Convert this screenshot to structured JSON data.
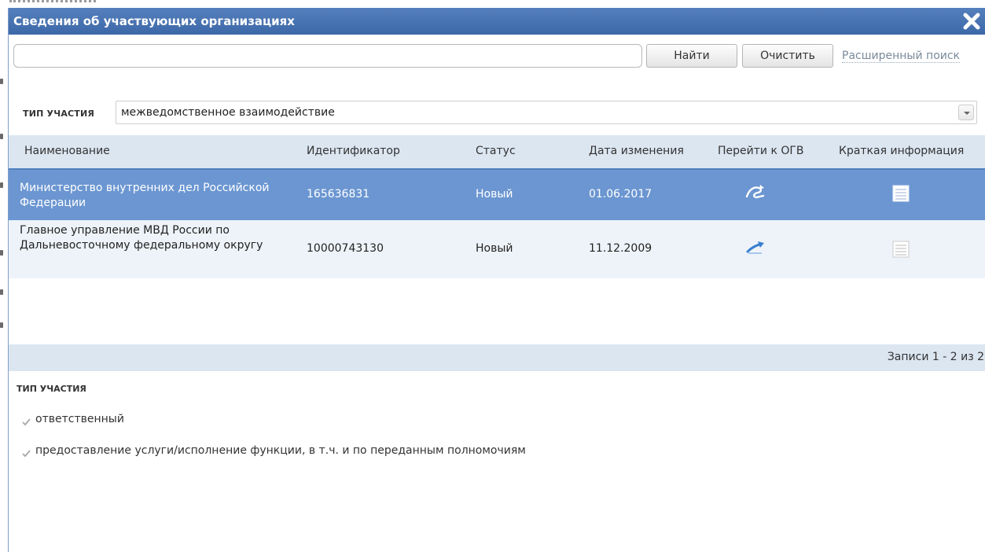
{
  "dialog": {
    "title": "Сведения об участвующих организациях",
    "close_icon": "close-icon"
  },
  "search": {
    "value": "",
    "placeholder": "",
    "find_label": "Найти",
    "clear_label": "Очистить",
    "advanced_label": "Расширенный поиск"
  },
  "filter": {
    "label": "ТИП УЧАСТИЯ",
    "selected": "межведомственное взаимодействие"
  },
  "table": {
    "headers": {
      "name": "Наименование",
      "id": "Идентификатор",
      "status": "Статус",
      "date": "Дата изменения",
      "goto": "Перейти к ОГВ",
      "info": "Краткая информация"
    },
    "rows": [
      {
        "name": "Министерство внутренних дел Российской Федерации",
        "id": "165636831",
        "status": "Новый",
        "date": "01.06.2017",
        "goto_icon": "go-to-ogv-icon",
        "info_icon": "document-info-icon",
        "selected": true
      },
      {
        "name": "Главное управление МВД России по Дальневосточному федеральному округу",
        "id": "10000743130",
        "status": "Новый",
        "date": "11.12.2009",
        "goto_icon": "go-to-ogv-icon",
        "info_icon": "document-info-icon",
        "selected": false
      }
    ]
  },
  "pager": {
    "text": "Записи 1 - 2 из 2"
  },
  "participation": {
    "label": "ТИП УЧАСТИЯ",
    "options": [
      {
        "label": "ответственный",
        "checked": true
      },
      {
        "label": "предоставление услуги/исполнение функции, в т.ч. и по переданным полномочиям",
        "checked": true
      }
    ]
  },
  "colors": {
    "titlebar": "#3d68a8",
    "header_bg": "#dce6f1",
    "selected_row": "#6b96d1",
    "alt_row": "#eef3f9"
  }
}
